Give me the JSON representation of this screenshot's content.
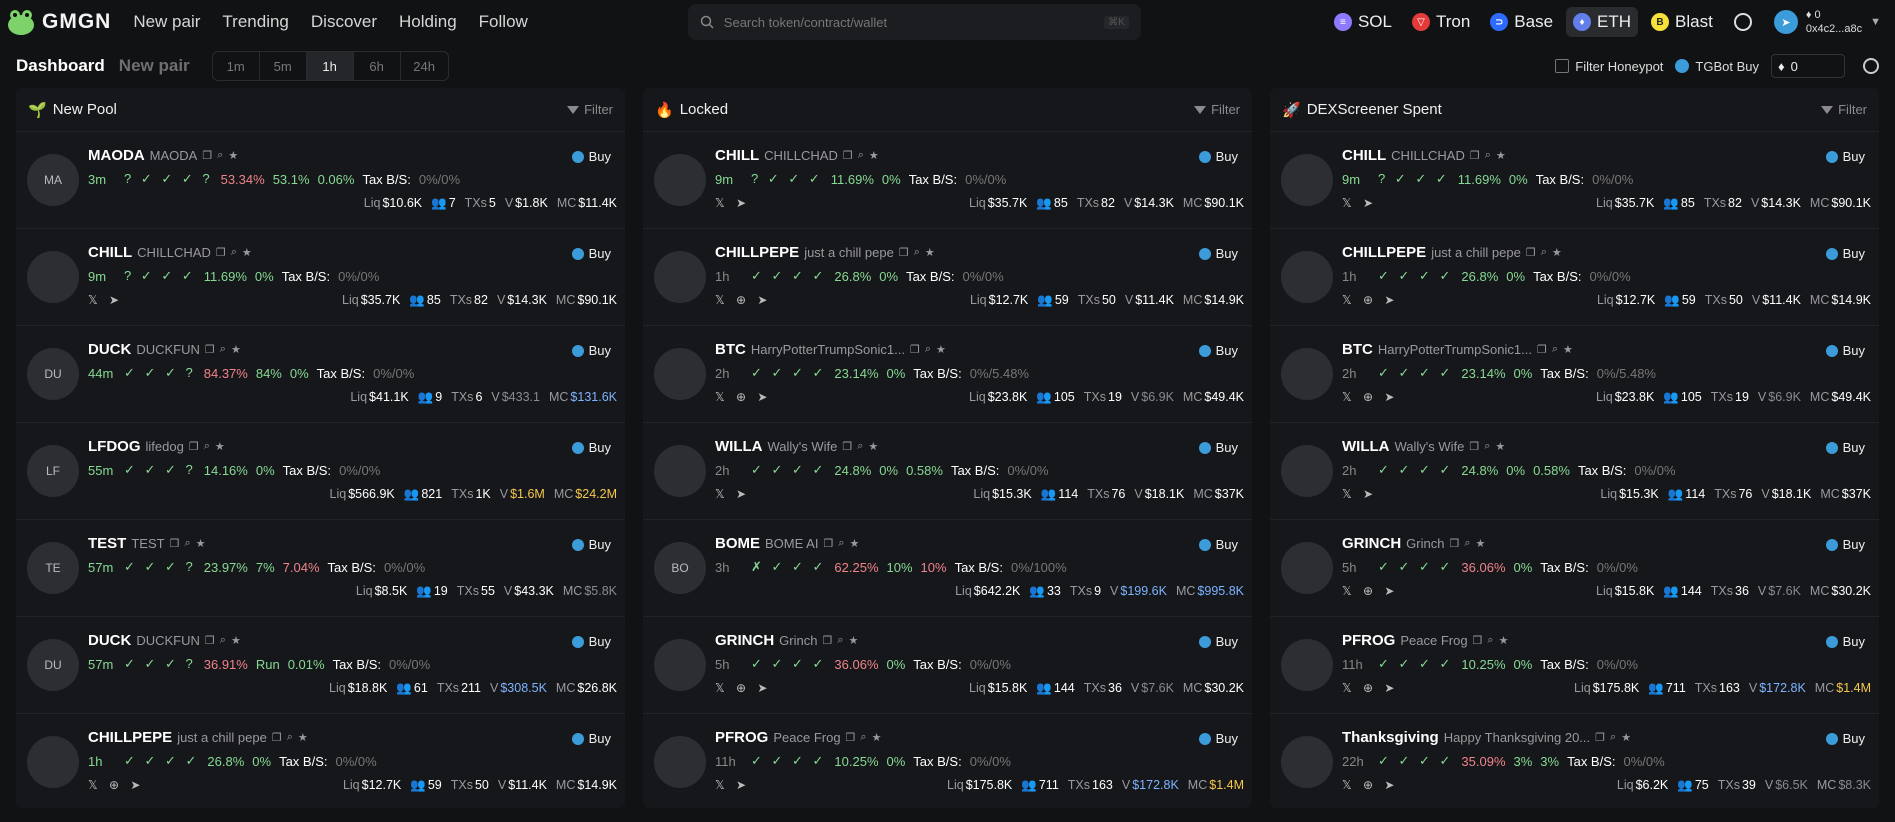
{
  "header": {
    "brand": "GMGN",
    "nav": [
      "New pair",
      "Trending",
      "Discover",
      "Holding",
      "Follow"
    ],
    "search_placeholder": "Search token/contract/wallet",
    "search_kbd": "⌘K",
    "chains": [
      {
        "name": "SOL",
        "color": "#8d7bff",
        "glyph": "≡"
      },
      {
        "name": "Tron",
        "color": "#e33a3a",
        "glyph": "▽"
      },
      {
        "name": "Base",
        "color": "#2d6bff",
        "glyph": "⊃"
      },
      {
        "name": "ETH",
        "color": "#627eea",
        "glyph": "♦"
      },
      {
        "name": "Blast",
        "color": "#f6e03a",
        "glyph": "B"
      }
    ],
    "wallet_balance": "0",
    "wallet_address": "0x4c2...a8c"
  },
  "subbar": {
    "title": "Dashboard",
    "new_pair": "New pair",
    "timeframes": [
      "1m",
      "5m",
      "1h",
      "6h",
      "24h"
    ],
    "active_tf": "1h",
    "filter_honeypot": "Filter Honeypot",
    "tgbot": "TGBot Buy",
    "amount": "0"
  },
  "buy_label": "Buy",
  "tax_label": "Tax B/S:",
  "columns": [
    {
      "title": "New Pool",
      "icon": "🌱",
      "filter": "Filter",
      "rows": [
        {
          "sym": "MAODA",
          "name": "MAODA",
          "avatar": "MA",
          "age": "3m",
          "checks": "? ✓ ✓ ✓ ?",
          "holders": "53.34%",
          "hcol": "pink",
          "top": "53.1%",
          "extra": "0.06%",
          "excol": "green",
          "tax": "0%/0%",
          "socials": "",
          "liq": "$10.6K",
          "h": "7",
          "txs": "5",
          "v": "$1.8K",
          "vcol": "white",
          "mc": "$11.4K",
          "mccol": "white"
        },
        {
          "sym": "CHILL",
          "name": "CHILLCHAD",
          "avatar": "",
          "age": "9m",
          "checks": "? ✓ ✓ ✓",
          "holders": "11.69%",
          "hcol": "green",
          "top": "0%",
          "extra": "",
          "excol": "green",
          "tax": "0%/0%",
          "socials": "𝕏 ➤",
          "liq": "$35.7K",
          "h": "85",
          "txs": "82",
          "v": "$14.3K",
          "vcol": "white",
          "mc": "$90.1K",
          "mccol": "white"
        },
        {
          "sym": "DUCK",
          "name": "DUCKFUN",
          "avatar": "DU",
          "age": "44m",
          "checks": "✓ ✓ ✓ ?",
          "holders": "84.37%",
          "hcol": "pink",
          "top": "84%",
          "extra": "0%",
          "excol": "green",
          "tax": "0%/0%",
          "socials": "",
          "liq": "$41.1K",
          "h": "9",
          "txs": "6",
          "v": "$433.1",
          "vcol": "gray",
          "mc": "$131.6K",
          "mccol": "blue"
        },
        {
          "sym": "LFDOG",
          "name": "lifedog",
          "avatar": "LF",
          "age": "55m",
          "checks": "✓ ✓ ✓ ?",
          "holders": "14.16%",
          "hcol": "green",
          "top": "0%",
          "extra": "",
          "excol": "green",
          "tax": "0%/0%",
          "socials": "",
          "liq": "$566.9K",
          "h": "821",
          "txs": "1K",
          "v": "$1.6M",
          "vcol": "yellow",
          "mc": "$24.2M",
          "mccol": "yellow"
        },
        {
          "sym": "TEST",
          "name": "TEST",
          "avatar": "TE",
          "age": "57m",
          "checks": "✓ ✓ ✓ ?",
          "holders": "23.97%",
          "hcol": "green",
          "top": "7%",
          "extra": "7.04%",
          "excol": "pink",
          "tax": "0%/0%",
          "socials": "",
          "liq": "$8.5K",
          "h": "19",
          "txs": "55",
          "v": "$43.3K",
          "vcol": "white",
          "mc": "$5.8K",
          "mccol": "gray"
        },
        {
          "sym": "DUCK",
          "name": "DUCKFUN",
          "avatar": "DU",
          "age": "57m",
          "checks": "✓ ✓ ✓ ?",
          "holders": "36.91%",
          "hcol": "pink",
          "top": "Run",
          "extra": "0.01%",
          "excol": "green",
          "tax": "0%/0%",
          "socials": "",
          "liq": "$18.8K",
          "h": "61",
          "txs": "211",
          "v": "$308.5K",
          "vcol": "blue",
          "mc": "$26.8K",
          "mccol": "white"
        },
        {
          "sym": "CHILLPEPE",
          "name": "just a chill pepe",
          "avatar": "",
          "age": "1h",
          "checks": "✓ ✓ ✓ ✓",
          "holders": "26.8%",
          "hcol": "green",
          "top": "0%",
          "extra": "",
          "excol": "green",
          "tax": "0%/0%",
          "socials": "𝕏 ⊕ ➤",
          "liq": "$12.7K",
          "h": "59",
          "txs": "50",
          "v": "$11.4K",
          "vcol": "white",
          "mc": "$14.9K",
          "mccol": "white"
        }
      ]
    },
    {
      "title": "Locked",
      "icon": "🔥",
      "filter": "Filter",
      "rows": [
        {
          "sym": "CHILL",
          "name": "CHILLCHAD",
          "avatar": "",
          "age": "9m",
          "checks": "? ✓ ✓ ✓",
          "holders": "11.69%",
          "hcol": "green",
          "top": "0%",
          "extra": "",
          "excol": "green",
          "tax": "0%/0%",
          "socials": "𝕏 ➤",
          "liq": "$35.7K",
          "h": "85",
          "txs": "82",
          "v": "$14.3K",
          "vcol": "white",
          "mc": "$90.1K",
          "mccol": "white"
        },
        {
          "sym": "CHILLPEPE",
          "name": "just a chill pepe",
          "avatar": "",
          "age": "1h",
          "checks": "✓ ✓ ✓ ✓",
          "holders": "26.8%",
          "hcol": "green",
          "top": "0%",
          "extra": "",
          "excol": "green",
          "tax": "0%/0%",
          "socials": "𝕏 ⊕ ➤",
          "liq": "$12.7K",
          "h": "59",
          "txs": "50",
          "v": "$11.4K",
          "vcol": "white",
          "mc": "$14.9K",
          "mccol": "white"
        },
        {
          "sym": "BTC",
          "name": "HarryPotterTrumpSonic1...",
          "avatar": "",
          "age": "2h",
          "checks": "✓ ✓ ✓ ✓",
          "holders": "23.14%",
          "hcol": "green",
          "top": "0%",
          "extra": "",
          "excol": "green",
          "tax": "0%/5.48%",
          "socials": "𝕏 ⊕ ➤",
          "liq": "$23.8K",
          "h": "105",
          "txs": "19",
          "v": "$6.9K",
          "vcol": "gray",
          "mc": "$49.4K",
          "mccol": "white"
        },
        {
          "sym": "WILLA",
          "name": "Wally's Wife",
          "avatar": "",
          "age": "2h",
          "checks": "✓ ✓ ✓ ✓",
          "holders": "24.8%",
          "hcol": "green",
          "top": "0%",
          "extra": "0.58%",
          "excol": "green",
          "tax": "0%/0%",
          "socials": "𝕏 ➤",
          "liq": "$15.3K",
          "h": "114",
          "txs": "76",
          "v": "$18.1K",
          "vcol": "white",
          "mc": "$37K",
          "mccol": "white"
        },
        {
          "sym": "BOME",
          "name": "BOME AI",
          "avatar": "BO",
          "age": "3h",
          "checks": "✗ ✓ ✓ ✓",
          "holders": "62.25%",
          "hcol": "pink",
          "top": "10%",
          "extra": "10%",
          "excol": "pink",
          "tax": "0%/100%",
          "socials": "",
          "liq": "$642.2K",
          "h": "33",
          "txs": "9",
          "v": "$199.6K",
          "vcol": "blue",
          "mc": "$995.8K",
          "mccol": "blue"
        },
        {
          "sym": "GRINCH",
          "name": "Grinch",
          "avatar": "",
          "age": "5h",
          "checks": "✓ ✓ ✓ ✓",
          "holders": "36.06%",
          "hcol": "pink",
          "top": "0%",
          "extra": "",
          "excol": "green",
          "tax": "0%/0%",
          "socials": "𝕏 ⊕ ➤",
          "liq": "$15.8K",
          "h": "144",
          "txs": "36",
          "v": "$7.6K",
          "vcol": "gray",
          "mc": "$30.2K",
          "mccol": "white"
        },
        {
          "sym": "PFROG",
          "name": "Peace Frog",
          "avatar": "",
          "age": "11h",
          "checks": "✓ ✓ ✓ ✓",
          "holders": "10.25%",
          "hcol": "green",
          "top": "0%",
          "extra": "",
          "excol": "green",
          "tax": "0%/0%",
          "socials": "𝕏 ➤",
          "liq": "$175.8K",
          "h": "711",
          "txs": "163",
          "v": "$172.8K",
          "vcol": "blue",
          "mc": "$1.4M",
          "mccol": "yellow"
        }
      ]
    },
    {
      "title": "DEXScreener Spent",
      "icon": "🚀",
      "filter": "Filter",
      "rows": [
        {
          "sym": "CHILL",
          "name": "CHILLCHAD",
          "avatar": "",
          "age": "9m",
          "checks": "? ✓ ✓ ✓",
          "holders": "11.69%",
          "hcol": "green",
          "top": "0%",
          "extra": "",
          "excol": "green",
          "tax": "0%/0%",
          "socials": "𝕏 ➤",
          "liq": "$35.7K",
          "h": "85",
          "txs": "82",
          "v": "$14.3K",
          "vcol": "white",
          "mc": "$90.1K",
          "mccol": "white"
        },
        {
          "sym": "CHILLPEPE",
          "name": "just a chill pepe",
          "avatar": "",
          "age": "1h",
          "checks": "✓ ✓ ✓ ✓",
          "holders": "26.8%",
          "hcol": "green",
          "top": "0%",
          "extra": "",
          "excol": "green",
          "tax": "0%/0%",
          "socials": "𝕏 ⊕ ➤",
          "liq": "$12.7K",
          "h": "59",
          "txs": "50",
          "v": "$11.4K",
          "vcol": "white",
          "mc": "$14.9K",
          "mccol": "white"
        },
        {
          "sym": "BTC",
          "name": "HarryPotterTrumpSonic1...",
          "avatar": "",
          "age": "2h",
          "checks": "✓ ✓ ✓ ✓",
          "holders": "23.14%",
          "hcol": "green",
          "top": "0%",
          "extra": "",
          "excol": "green",
          "tax": "0%/5.48%",
          "socials": "𝕏 ⊕ ➤",
          "liq": "$23.8K",
          "h": "105",
          "txs": "19",
          "v": "$6.9K",
          "vcol": "gray",
          "mc": "$49.4K",
          "mccol": "white"
        },
        {
          "sym": "WILLA",
          "name": "Wally's Wife",
          "avatar": "",
          "age": "2h",
          "checks": "✓ ✓ ✓ ✓",
          "holders": "24.8%",
          "hcol": "green",
          "top": "0%",
          "extra": "0.58%",
          "excol": "green",
          "tax": "0%/0%",
          "socials": "𝕏 ➤",
          "liq": "$15.3K",
          "h": "114",
          "txs": "76",
          "v": "$18.1K",
          "vcol": "white",
          "mc": "$37K",
          "mccol": "white"
        },
        {
          "sym": "GRINCH",
          "name": "Grinch",
          "avatar": "",
          "age": "5h",
          "checks": "✓ ✓ ✓ ✓",
          "holders": "36.06%",
          "hcol": "pink",
          "top": "0%",
          "extra": "",
          "excol": "green",
          "tax": "0%/0%",
          "socials": "𝕏 ⊕ ➤",
          "liq": "$15.8K",
          "h": "144",
          "txs": "36",
          "v": "$7.6K",
          "vcol": "gray",
          "mc": "$30.2K",
          "mccol": "white"
        },
        {
          "sym": "PFROG",
          "name": "Peace Frog",
          "avatar": "",
          "age": "11h",
          "checks": "✓ ✓ ✓ ✓",
          "holders": "10.25%",
          "hcol": "green",
          "top": "0%",
          "extra": "",
          "excol": "green",
          "tax": "0%/0%",
          "socials": "𝕏 ⊕ ➤",
          "liq": "$175.8K",
          "h": "711",
          "txs": "163",
          "v": "$172.8K",
          "vcol": "blue",
          "mc": "$1.4M",
          "mccol": "yellow"
        },
        {
          "sym": "Thanksgiving",
          "name": "Happy Thanksgiving 20...",
          "avatar": "",
          "age": "22h",
          "checks": "✓ ✓ ✓ ✓",
          "holders": "35.09%",
          "hcol": "pink",
          "top": "3%",
          "extra": "3%",
          "excol": "green",
          "tax": "0%/0%",
          "socials": "𝕏 ⊕ ➤",
          "liq": "$6.2K",
          "h": "75",
          "txs": "39",
          "v": "$6.5K",
          "vcol": "gray",
          "mc": "$8.3K",
          "mccol": "gray"
        }
      ]
    }
  ]
}
